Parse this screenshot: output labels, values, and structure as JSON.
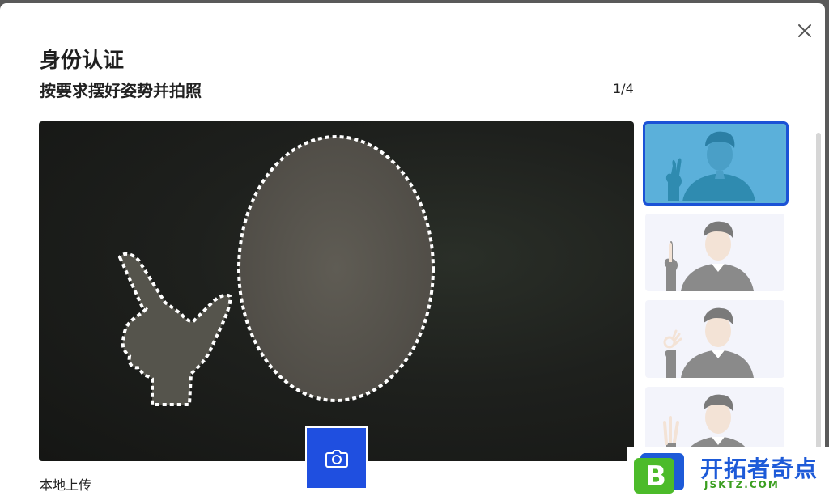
{
  "dialog": {
    "title": "身份认证",
    "instruction": "按要求摆好姿势并拍照",
    "step_counter": "1/4",
    "upload_label": "本地上传"
  },
  "icons": {
    "close": "close-icon",
    "capture": "camera-icon"
  },
  "thumbnails": [
    {
      "pose": "v-sign",
      "selected": true
    },
    {
      "pose": "index-finger",
      "selected": false
    },
    {
      "pose": "ok-sign",
      "selected": false
    },
    {
      "pose": "three-fingers",
      "selected": false
    }
  ],
  "watermark": {
    "text": "开拓者奇点",
    "sub": "JSKTZ.COM",
    "letter": "B"
  },
  "colors": {
    "accent": "#1f4fe0",
    "selected_border": "#1b52d6",
    "selected_bg": "#5bb0da"
  }
}
